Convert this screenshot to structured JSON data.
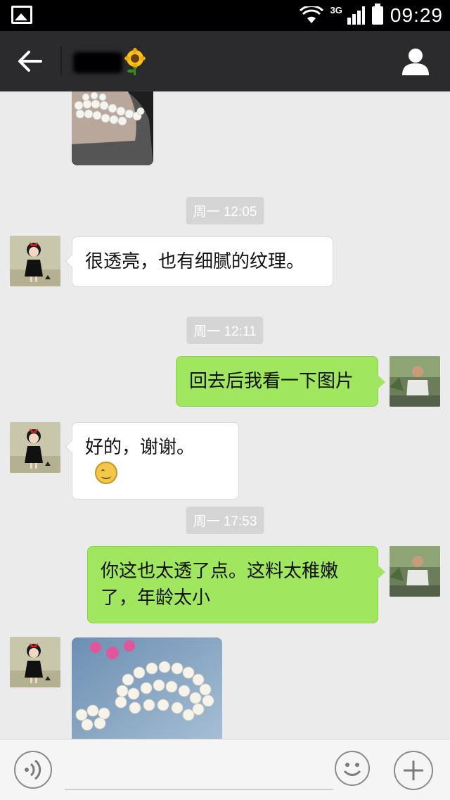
{
  "status_bar": {
    "time": "09:29",
    "network": "3G",
    "icons": [
      "image-notification-icon",
      "wifi-icon",
      "signal-icon",
      "battery-icon"
    ]
  },
  "header": {
    "contact_name": "███",
    "icons": [
      "back-arrow-icon",
      "sunflower-emoji-icon",
      "profile-icon"
    ]
  },
  "messages": [
    {
      "type": "image",
      "side": "incoming",
      "description": "bracelet-photo"
    },
    {
      "type": "timestamp",
      "text": "周一 12:05"
    },
    {
      "type": "text",
      "side": "incoming",
      "text": "很透亮，也有细腻的纹理。"
    },
    {
      "type": "timestamp",
      "text": "周一 12:11"
    },
    {
      "type": "text",
      "side": "outgoing",
      "text": "回去后我看一下图片"
    },
    {
      "type": "text",
      "side": "incoming",
      "text": "好的，谢谢。",
      "emoji": "smile-emoji-icon"
    },
    {
      "type": "timestamp",
      "text": "周一 17:53"
    },
    {
      "type": "text",
      "side": "outgoing",
      "text": "你这也太透了点。这料太稚嫩了，年龄太小"
    },
    {
      "type": "image",
      "side": "incoming",
      "description": "beads-photo"
    }
  ],
  "input_bar": {
    "icons": [
      "voice-icon",
      "emoji-icon",
      "plus-icon"
    ]
  },
  "colors": {
    "outgoing_bubble": "#a0e65f",
    "incoming_bubble": "#ffffff",
    "header_bg": "#2b2b2d",
    "chat_bg": "#ebebeb"
  }
}
